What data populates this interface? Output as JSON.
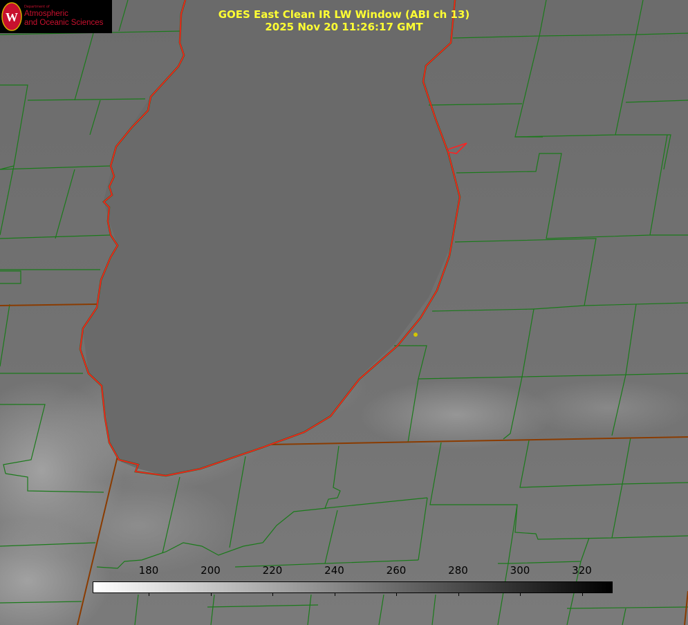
{
  "title": {
    "line1": "GOES East Clean IR LW Window (ABI ch 13)",
    "line2": "2025 Nov 20 11:26:17 GMT"
  },
  "logo": {
    "line1": "Department of",
    "line2": "Atmospheric",
    "line3": "and Oceanic Sciences",
    "seal_letter": "W",
    "color": "#c8102e"
  },
  "colorbar": {
    "ticks": [
      "180",
      "200",
      "220",
      "240",
      "260",
      "280",
      "300",
      "320"
    ],
    "min_color": "#ffffff",
    "max_color": "#000000"
  },
  "colors": {
    "title": "#ffff33",
    "county_lines": "#1a7a1a",
    "shoreline": "#ff2020",
    "state_lines": "#8a3b00",
    "marker": "#d4c600"
  }
}
